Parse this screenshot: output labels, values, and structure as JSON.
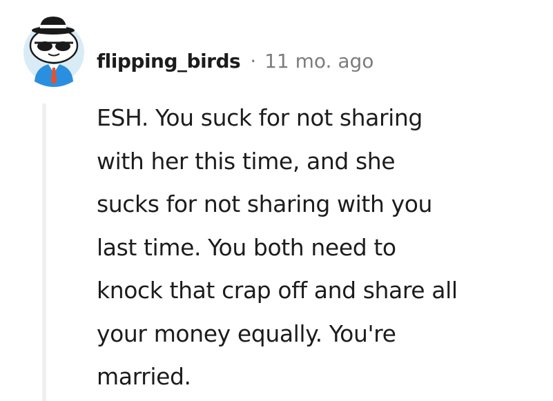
{
  "comment": {
    "author": "flipping_birds",
    "separator": "·",
    "timestamp": "11 mo. ago",
    "avatar_icon": "snoo-avatar-hat-sunglasses-icon",
    "body_lines": [
      "ESH. You suck for not sharing",
      "with her this time, and she",
      "sucks for not sharing with you",
      "last time. You both need to",
      "knock that crap off and share all",
      "your money equally. You're",
      "married."
    ]
  },
  "colors": {
    "text": "#1c1c1c",
    "meta": "#7c7c7c",
    "thread_line": "#edeff1",
    "avatar_bg": "#d9ecf6",
    "suit": "#2b8fe0",
    "tie": "#e8502a",
    "hat": "#1a1a1a"
  }
}
